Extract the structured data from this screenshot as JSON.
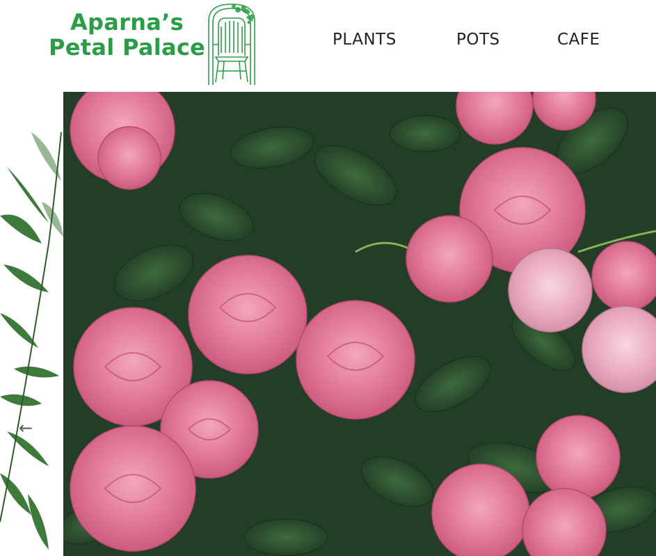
{
  "brand": {
    "line1": "Aparna’s",
    "line2": "Petal Palace",
    "color": "#2a9d46",
    "logo_icon": "garden-chair-icon"
  },
  "nav": {
    "items": [
      {
        "label": "PLANTS"
      },
      {
        "label": "POTS"
      },
      {
        "label": "CAFE"
      }
    ]
  },
  "hero": {
    "image": "pink-roses-photo",
    "prev_arrow": "←",
    "leaf_color": "#2f4f2f",
    "rose_color": "#e7809f"
  }
}
